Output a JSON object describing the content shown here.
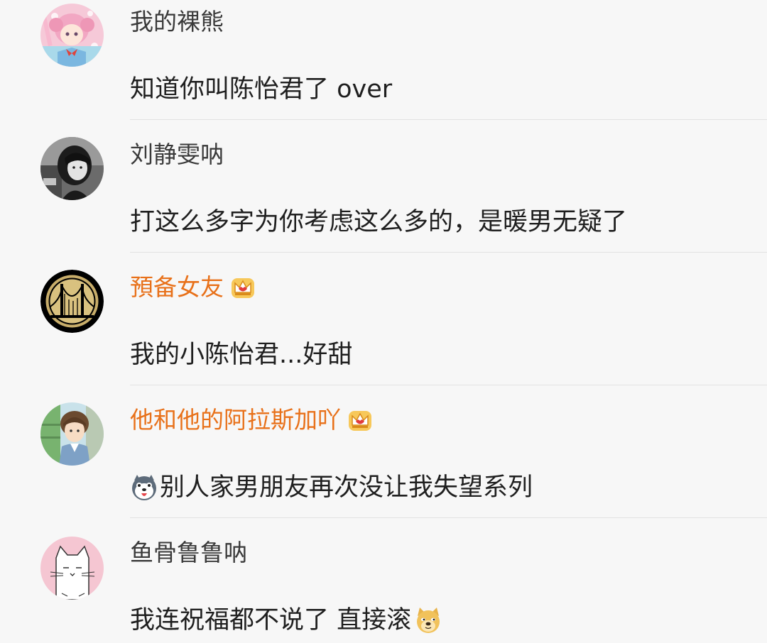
{
  "comments": [
    {
      "username": "我的裸熊",
      "text": "知道你叫陈怡君了 over",
      "vip": false
    },
    {
      "username": "刘静雯呐",
      "text": "打这么多字为你考虑这么多的，是暖男无疑了",
      "vip": false
    },
    {
      "username": "預备女友",
      "text": "我的小陈怡君...好甜",
      "vip": true
    },
    {
      "username": "他和他的阿拉斯加吖",
      "text": "别人家男朋友再次没让我失望系列",
      "vip": true
    },
    {
      "username": "鱼骨鲁鲁呐",
      "text": "我连祝福都不说了 直接滚",
      "vip": false
    }
  ],
  "icons": {
    "vip_badge": "crown-icon",
    "comment4_leading_emoji": "husky-emoji-icon",
    "comment5_trailing_emoji": "doge-emoji-icon"
  },
  "colors": {
    "background": "#f7f7f7",
    "username": "#3a3a3a",
    "vip_username": "#e8711a",
    "text": "#1f1f1f",
    "divider": "#e2e2e2"
  }
}
